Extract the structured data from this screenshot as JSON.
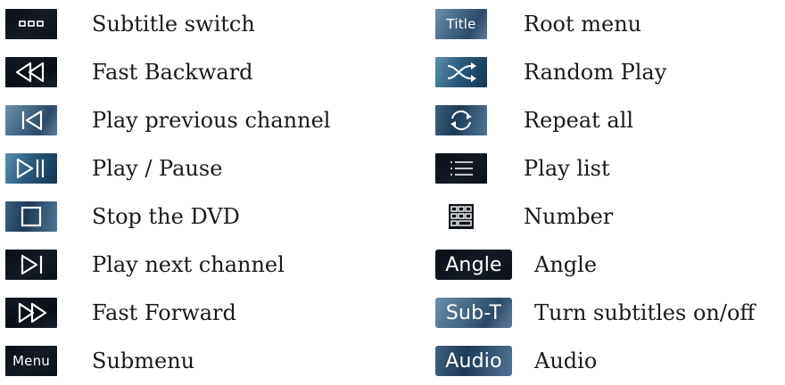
{
  "left_items": [
    {
      "icon": "subtitle-switch-icon",
      "label": "Subtitle switch"
    },
    {
      "icon": "fast-backward-icon",
      "label": "Fast Backward"
    },
    {
      "icon": "previous-channel-icon",
      "label": "Play previous channel"
    },
    {
      "icon": "play-pause-icon",
      "label": "Play / Pause"
    },
    {
      "icon": "stop-icon",
      "label": "Stop the DVD"
    },
    {
      "icon": "next-channel-icon",
      "label": "Play next channel"
    },
    {
      "icon": "fast-forward-icon",
      "label": "Fast Forward"
    },
    {
      "icon": "menu-icon",
      "icon_text": "Menu",
      "label": "Submenu"
    }
  ],
  "right_items": [
    {
      "icon": "title-icon",
      "icon_text": "Title",
      "label": "Root menu"
    },
    {
      "icon": "shuffle-icon",
      "label": "Random Play"
    },
    {
      "icon": "repeat-icon",
      "label": "Repeat all"
    },
    {
      "icon": "playlist-icon",
      "label": "Play list"
    },
    {
      "icon": "number-pad-icon",
      "label": "Number"
    },
    {
      "icon": "angle-icon",
      "icon_text": "Angle",
      "label": "Angle"
    },
    {
      "icon": "sub-t-icon",
      "icon_text": "Sub-T",
      "label": "Turn subtitles on/off"
    },
    {
      "icon": "audio-icon",
      "icon_text": "Audio",
      "label": "Audio"
    }
  ],
  "colors": {
    "icon_dark": "#0b0f16",
    "icon_blue": "#4b6d8b",
    "glyph": "#ffffff",
    "text": "#1a1a1a"
  }
}
